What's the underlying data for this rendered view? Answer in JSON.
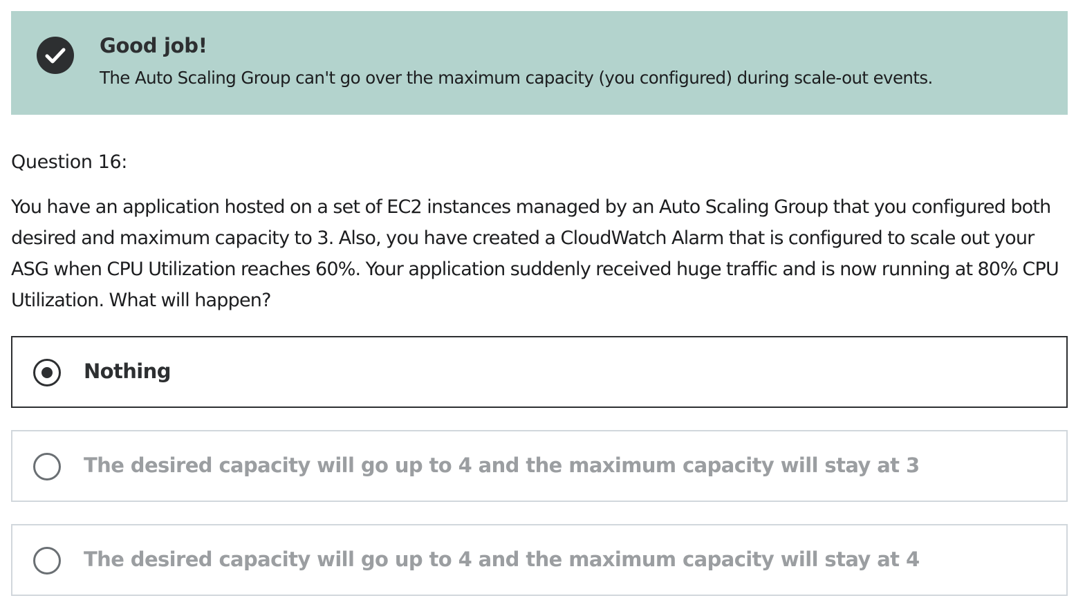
{
  "banner": {
    "icon": "check-circle-icon",
    "title": "Good job!",
    "message": "The Auto Scaling Group can't go over the maximum capacity (you configured) during scale-out events.",
    "background_color": "#b3d3cd"
  },
  "question": {
    "label": "Question 16:",
    "text": "You have an application hosted on a set of EC2 instances managed by an Auto Scaling Group that you configured both desired and maximum capacity to 3. Also, you have created a CloudWatch Alarm that is configured to scale out your ASG when CPU Utilization reaches 60%. Your application suddenly received huge traffic and is now running at 80% CPU Utilization. What will happen?"
  },
  "options": [
    {
      "label": "Nothing",
      "selected": true
    },
    {
      "label": "The desired capacity will go up to 4 and the maximum capacity will stay at 3",
      "selected": false
    },
    {
      "label": "The desired capacity will go up to 4 and the maximum capacity will stay at 4",
      "selected": false
    }
  ]
}
